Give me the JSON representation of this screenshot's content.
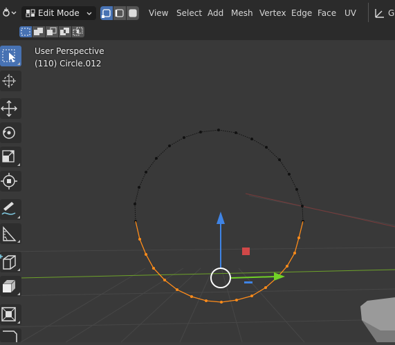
{
  "header": {
    "mode_label": "Edit Mode",
    "menu": [
      "View",
      "Select",
      "Add",
      "Mesh",
      "Vertex",
      "Edge",
      "Face",
      "UV"
    ],
    "overflow_label": "G"
  },
  "viewport": {
    "view_name": "User Perspective",
    "object_info": "(110) Circle.012"
  },
  "colors": {
    "header_bg": "#2b2b2b",
    "viewport_bg": "#393939",
    "active_blue": "#4772b3",
    "selected_orange": "#ff8c1a",
    "axis_x_red": "#a83a3a",
    "axis_y_green": "#6ea32a",
    "gizmo_blue": "#3f84e5",
    "gizmo_green": "#71d126",
    "gizmo_red": "#d04848"
  },
  "icons": {
    "editor_type": "3d-viewport-icon",
    "mode": "edit-mode-icon",
    "select_modes": [
      "vertex-select-icon",
      "edge-select-icon",
      "face-select-icon"
    ],
    "selection_ops": [
      "select-new-icon",
      "select-extend-icon",
      "select-subtract-icon",
      "select-difference-icon",
      "select-intersect-icon"
    ],
    "tools": [
      "select-box-icon",
      "cursor-icon",
      "move-icon",
      "rotate-icon",
      "scale-icon",
      "transform-icon",
      "annotate-icon",
      "measure-icon",
      "add-cube-icon",
      "extrude-icon",
      "inset-icon"
    ]
  }
}
